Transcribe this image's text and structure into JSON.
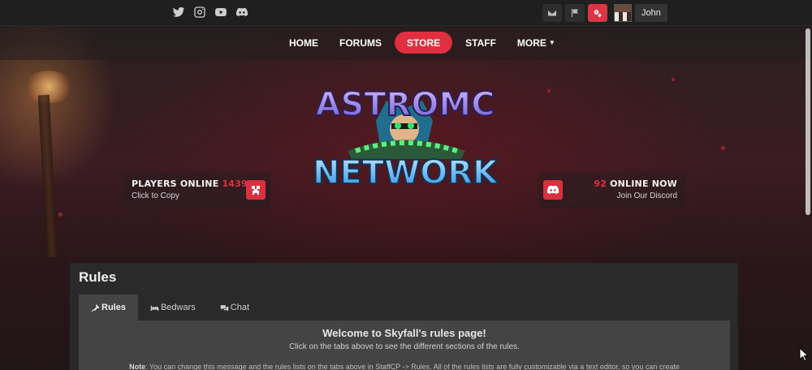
{
  "social": [
    "twitter-icon",
    "instagram-icon",
    "youtube-icon",
    "discord-icon"
  ],
  "user": {
    "name": "John"
  },
  "nav": {
    "items": [
      "HOME",
      "FORUMS",
      "STORE",
      "STAFF",
      "MORE"
    ]
  },
  "logo": {
    "line1": "ASTROMC",
    "line2": "NETWORK"
  },
  "stats": {
    "players": {
      "label": "PLAYERS ONLINE",
      "count": "143961",
      "sub": "Click to Copy"
    },
    "discord": {
      "count": "92",
      "label": "ONLINE NOW",
      "sub": "Join Our Discord"
    }
  },
  "rules": {
    "title": "Rules",
    "tabs": [
      "Rules",
      "Bedwars",
      "Chat"
    ],
    "welcome": "Welcome to Skyfall's rules page!",
    "hint": "Click on the tabs above to see the different sections of the rules.",
    "note_label": "Note",
    "note_text": ": You can change this message and the rules lists on the tabs above in StaffCP -> Rules. All of the rules lists are fully customizable via a text editor, so you can create"
  },
  "colors": {
    "accent": "#e0303f",
    "topbar": "#1f1f1f",
    "card": "#2a2a2a",
    "panel": "#444444"
  }
}
